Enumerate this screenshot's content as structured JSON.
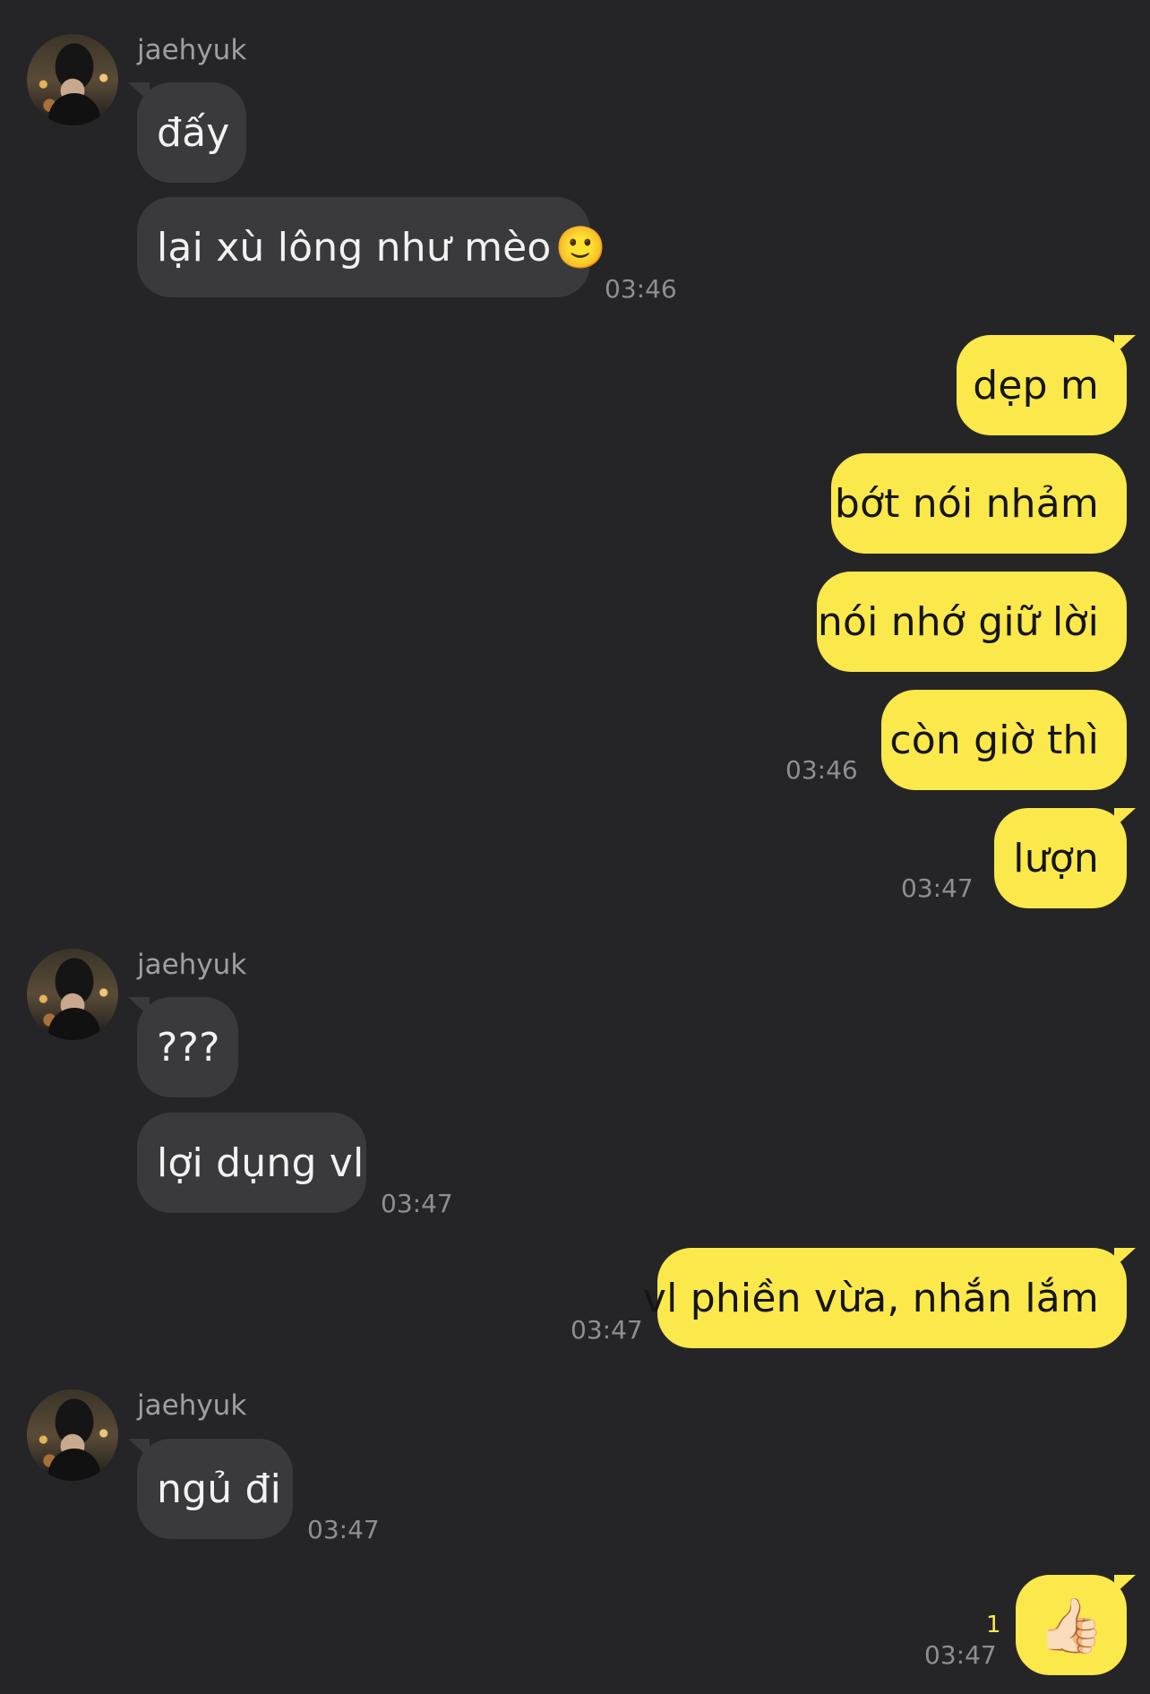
{
  "contact": {
    "name": "jaehyuk"
  },
  "messages": [
    {
      "from": "them",
      "text": "đấy"
    },
    {
      "from": "them",
      "text": "lại xù lông như mèo",
      "emoji": "🙂",
      "time": "03:46"
    },
    {
      "from": "me",
      "text": "dẹp m"
    },
    {
      "from": "me",
      "text": "bớt nói nhảm"
    },
    {
      "from": "me",
      "text": "nói nhớ giữ lời"
    },
    {
      "from": "me",
      "text": "còn giờ thì",
      "time": "03:46"
    },
    {
      "from": "me",
      "text": "lượn",
      "time": "03:47"
    },
    {
      "from": "them",
      "text": "???"
    },
    {
      "from": "them",
      "text": "lợi dụng vl",
      "time": "03:47"
    },
    {
      "from": "me",
      "text": "vl phiền vừa, nhắn lắm",
      "time": "03:47"
    },
    {
      "from": "them",
      "text": "ngủ đi",
      "time": "03:47"
    },
    {
      "from": "me",
      "text": "👍🏻",
      "time": "03:47",
      "unread_count": "1"
    }
  ],
  "colors": {
    "background": "#252527",
    "incoming_bubble": "#3a3a3c",
    "outgoing_bubble": "#fbe84a"
  }
}
